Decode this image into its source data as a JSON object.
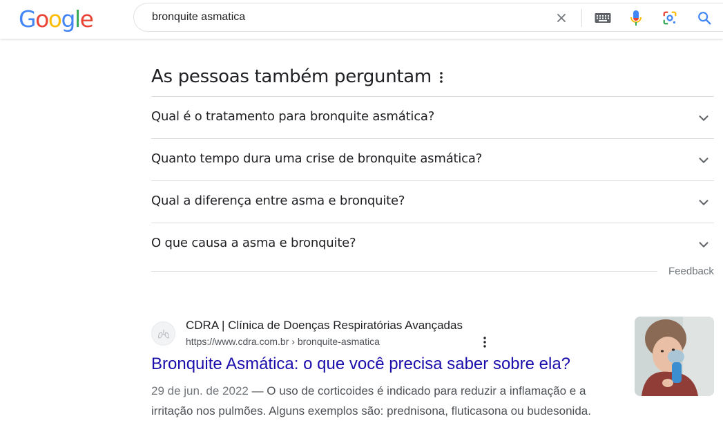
{
  "header": {
    "logo_letters": [
      "G",
      "o",
      "o",
      "g",
      "l",
      "e"
    ],
    "logo_colors": [
      "#4285F4",
      "#EA4335",
      "#FBBC05",
      "#4285F4",
      "#34A853",
      "#EA4335"
    ],
    "search_value": "bronquite asmatica",
    "icons": [
      "close-icon",
      "keyboard-icon",
      "microphone-icon",
      "lens-icon",
      "search-icon"
    ]
  },
  "paa": {
    "title": "As pessoas também perguntam",
    "questions": [
      "Qual é o tratamento para bronquite asmática?",
      "Quanto tempo dura uma crise de bronquite asmática?",
      "Qual a diferença entre asma e bronquite?",
      "O que causa a asma e bronquite?"
    ],
    "feedback": "Feedback"
  },
  "result": {
    "site_name": "CDRA | Clínica de Doenças Respiratórias Avançadas",
    "url": "https://www.cdra.com.br › bronquite-asmatica",
    "title": "Bronquite Asmática: o que você precisa saber sobre ela?",
    "date": "29 de jun. de 2022",
    "snippet": " — O uso de corticoides é indicado para reduzir a inflamação e a irritação nos pulmões. Alguns exemplos são: prednisona, fluticasona ou budesonida."
  },
  "colors": {
    "link": "#1a0dab",
    "text": "#202124",
    "muted": "#4d5156"
  }
}
